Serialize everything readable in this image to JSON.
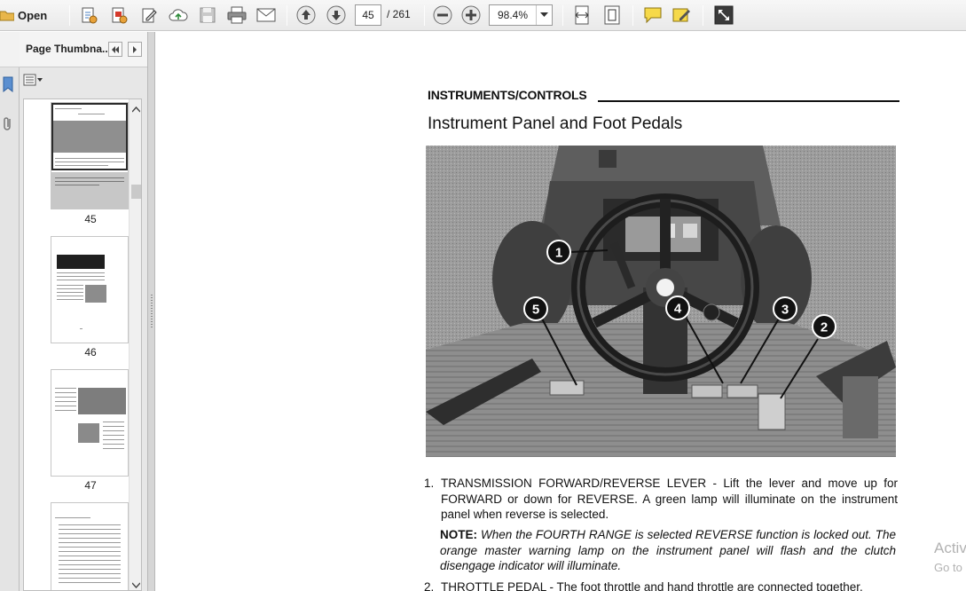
{
  "toolbar": {
    "open_label": "Open",
    "page_current": "45",
    "page_total": "/ 261",
    "zoom_value": "98.4%"
  },
  "thumbnails_panel": {
    "title": "Page Thumbna...",
    "thumbnails": [
      {
        "label": "45",
        "selected": true
      },
      {
        "label": "46",
        "selected": false
      },
      {
        "label": "47",
        "selected": false
      }
    ]
  },
  "document": {
    "section_header": "INSTRUMENTS/CONTROLS",
    "page_title": "Instrument Panel and Foot Pedals",
    "callouts": [
      "1",
      "2",
      "3",
      "4",
      "5"
    ],
    "item1_number": "1.",
    "item1_text": "TRANSMISSION FORWARD/REVERSE LEVER - Lift the lever and move up for FORWARD or down for REVERSE. A green lamp will illuminate on the instrument panel when reverse is selected.",
    "note_label": "NOTE:",
    "note_text": "When the FOURTH RANGE is selected REVERSE function is locked out. The orange master warning lamp on the instrument panel will flash and the clutch disengage indicator will illuminate.",
    "item2_number": "2.",
    "item2_text": "THROTTLE PEDAL - The foot throttle and hand throttle are connected together."
  },
  "overlay": {
    "line1": "Activ",
    "line2": "Go to"
  },
  "colors": {
    "toolbar_bg": "#ececec",
    "panel_bg": "#e7e7e7",
    "selected_thumb_border": "#2b2b2b"
  }
}
